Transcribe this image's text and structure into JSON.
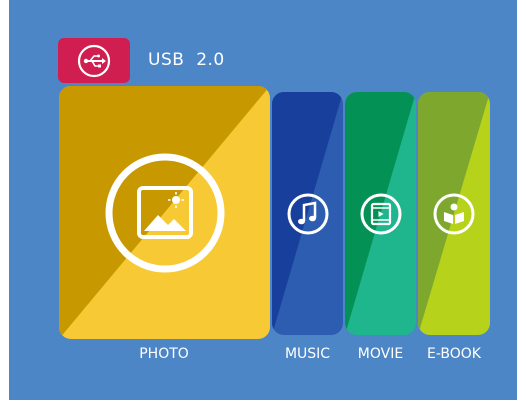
{
  "header": {
    "usb_label": "USB  2.0",
    "usb_icon": "usb-icon"
  },
  "colors": {
    "background": "#4d86c6",
    "usb_badge": "#d11e50",
    "photo": [
      "#c89800",
      "#f7c934"
    ],
    "music": [
      "#173f9b",
      "#2c5db1"
    ],
    "movie": [
      "#049155",
      "#1fb58d"
    ],
    "ebook": [
      "#7da82d",
      "#b7d21b"
    ]
  },
  "tiles": [
    {
      "id": "photo",
      "label": "PHOTO",
      "icon": "image-icon"
    },
    {
      "id": "music",
      "label": "MUSIC",
      "icon": "music-note-icon"
    },
    {
      "id": "movie",
      "label": "MOVIE",
      "icon": "film-icon"
    },
    {
      "id": "ebook",
      "label": "E-BOOK",
      "icon": "book-icon"
    }
  ]
}
